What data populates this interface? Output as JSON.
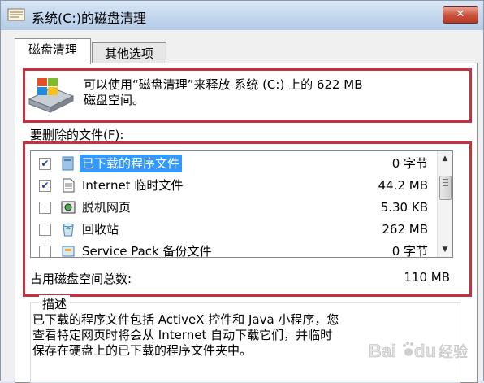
{
  "window": {
    "title": "系统(C:)的磁盘清理",
    "close_label": "✕"
  },
  "tabs": [
    {
      "label": "磁盘清理",
      "active": true
    },
    {
      "label": "其他选项",
      "active": false
    }
  ],
  "summary": {
    "line1": "可以使用“磁盘清理”来释放 系统 (C:) 上的 622 MB",
    "line2": "磁盘空间。"
  },
  "files_label": "要删除的文件(F):",
  "files": [
    {
      "name": "已下载的程序文件",
      "size": "0 字节",
      "checked": true,
      "selected": true,
      "icon": "folder-icon"
    },
    {
      "name": "Internet 临时文件",
      "size": "44.2 MB",
      "checked": true,
      "selected": false,
      "icon": "document-icon"
    },
    {
      "name": "脱机网页",
      "size": "5.30 KB",
      "checked": false,
      "selected": false,
      "icon": "offline-page-icon"
    },
    {
      "name": "回收站",
      "size": "262 MB",
      "checked": false,
      "selected": false,
      "icon": "recycle-bin-icon"
    },
    {
      "name": "Service Pack 备份文件",
      "size": "0 字节",
      "checked": false,
      "selected": false,
      "icon": "backup-icon"
    }
  ],
  "total": {
    "label": "占用磁盘空间总数:",
    "value": "110 MB"
  },
  "description": {
    "heading": "描述",
    "line1": "已下载的程序文件包括 ActiveX 控件和 Java 小程序，您",
    "line2": "查看特定网页时将会从 Internet 自动下载它们，并临时",
    "line3": "保存在硬盘上的已下载的程序文件夹中。"
  },
  "watermark": {
    "brand": "Bai",
    "paw": "du",
    "suffix": "经验"
  },
  "colors": {
    "highlight": "#c5313d",
    "selection": "#3399ff"
  }
}
